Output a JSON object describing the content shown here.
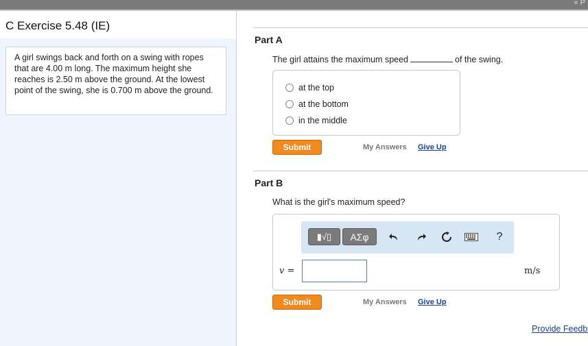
{
  "header": {
    "nav_glyph": "« P"
  },
  "exercise": {
    "title": "C Exercise 5.48 (IE)",
    "problem_text": "A girl swings back and forth on a swing with ropes that are 4.00 m long. The maximum height she reaches is 2.50 m above the ground. At the lowest point of the swing, she is 0.700 m above the ground."
  },
  "part_a": {
    "label": "Part A",
    "question_before": "The girl attains the maximum speed",
    "question_after": "of the swing.",
    "options": [
      {
        "label": "at the top",
        "selected": false
      },
      {
        "label": "at the bottom",
        "selected": false
      },
      {
        "label": "in the middle",
        "selected": false
      }
    ],
    "submit_label": "Submit",
    "my_answers_label": "My Answers",
    "give_up_label": "Give Up"
  },
  "part_b": {
    "label": "Part B",
    "question": "What is the girl's maximum speed?",
    "toolbar": {
      "templates_label": "▮√▯",
      "symbols_label": "ΑΣφ",
      "icons": [
        "undo-icon",
        "redo-icon",
        "reset-icon",
        "keyboard-icon",
        "help-icon"
      ]
    },
    "variable_label": "v =",
    "answer_value": "",
    "unit": "m/s",
    "submit_label": "Submit",
    "my_answers_label": "My Answers",
    "give_up_label": "Give Up"
  },
  "footer": {
    "feedback_label": "Provide Feedback"
  },
  "colors": {
    "submit": "#f08a1f",
    "link": "#1a3e8c",
    "left_panel": "#eef5fc",
    "toolbar": "#d6e6f5"
  }
}
